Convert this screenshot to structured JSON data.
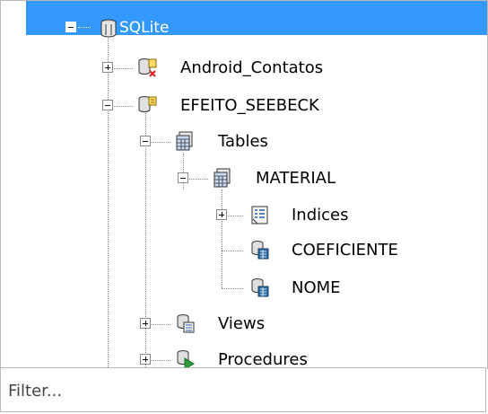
{
  "tree": {
    "root": {
      "label": "SQLite",
      "expanded": true,
      "icon": "database-group-icon"
    },
    "items": [
      {
        "label": "Android_Contatos",
        "expanded": false,
        "icon": "database-disconnected-icon"
      },
      {
        "label": "EFEITO_SEEBECK",
        "expanded": true,
        "icon": "database-connected-icon"
      },
      {
        "label": "Tables",
        "expanded": true,
        "icon": "tables-icon"
      },
      {
        "label": "MATERIAL",
        "expanded": true,
        "icon": "table-icon"
      },
      {
        "label": "Indices",
        "expanded": false,
        "icon": "indices-icon"
      },
      {
        "label": "COEFICIENTE",
        "icon": "column-icon"
      },
      {
        "label": "NOME",
        "icon": "column-icon"
      },
      {
        "label": "Views",
        "expanded": false,
        "icon": "views-icon"
      },
      {
        "label": "Procedures",
        "expanded": false,
        "icon": "procedures-icon"
      }
    ]
  },
  "filter": {
    "placeholder": "Filter...",
    "value": ""
  },
  "colors": {
    "selection": "#3399ff",
    "tree_lines": "#8a8a8a",
    "border": "#b7b7b7"
  }
}
